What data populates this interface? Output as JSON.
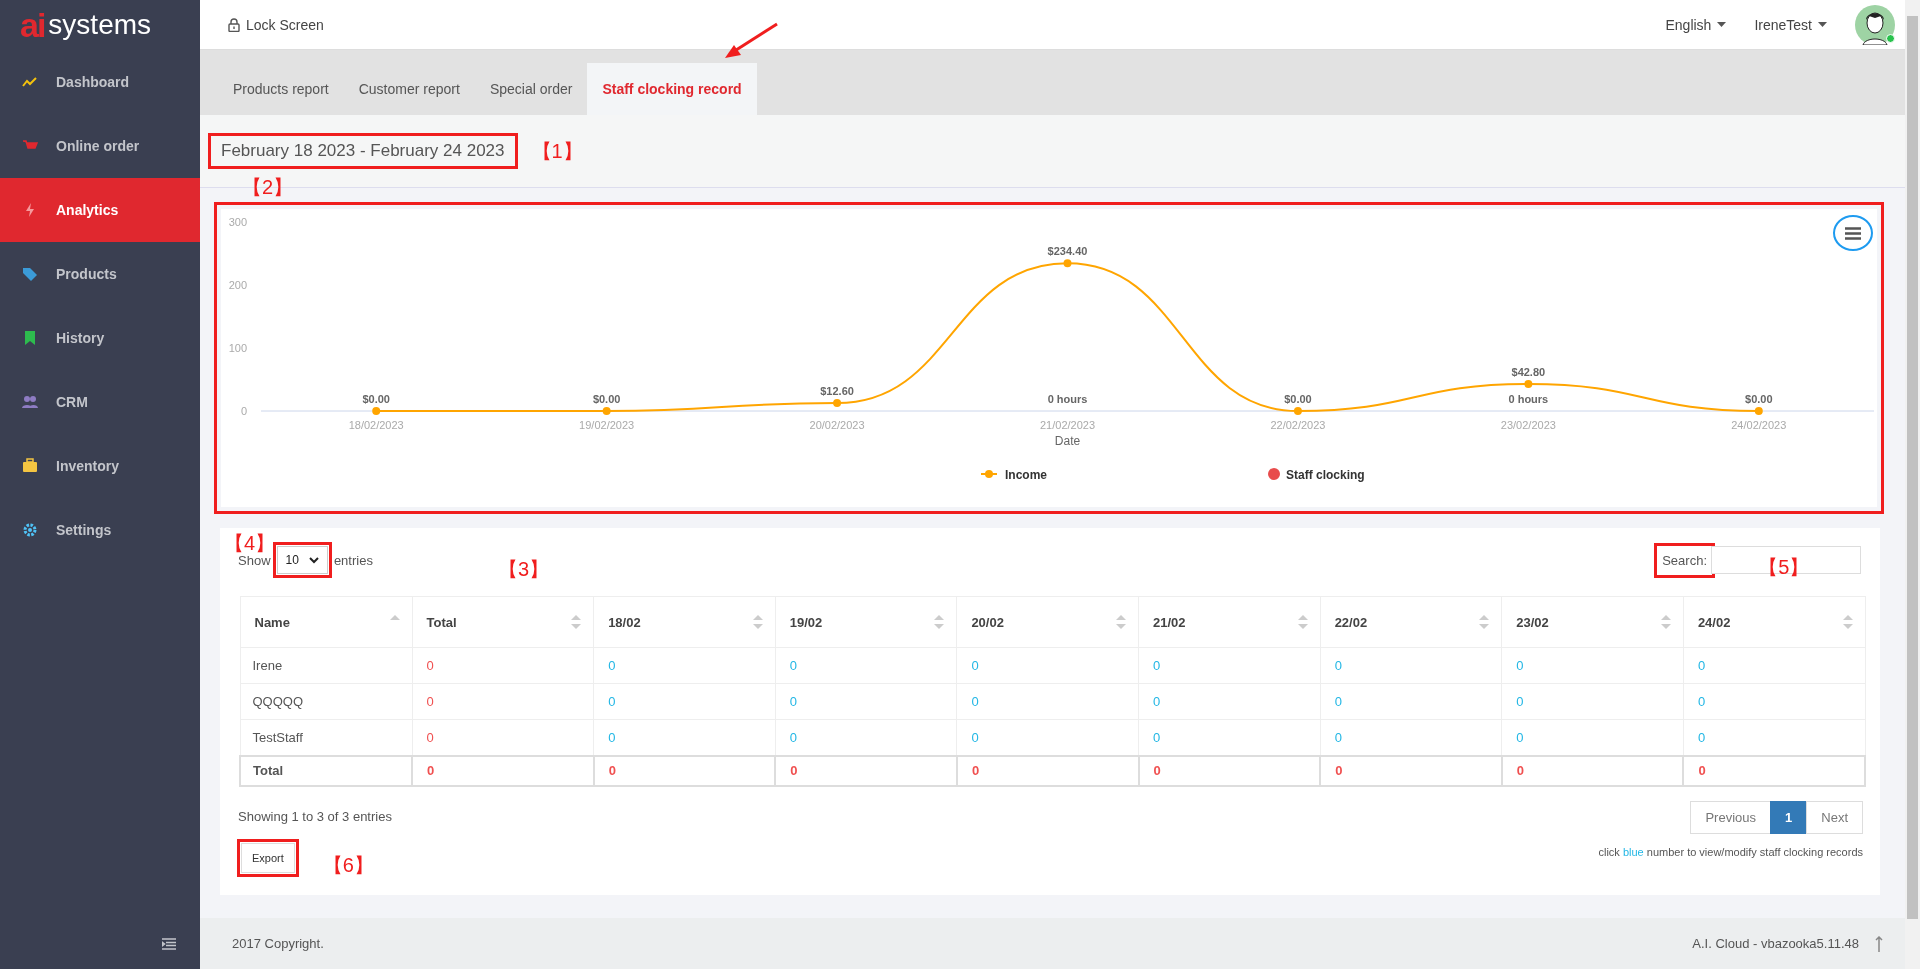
{
  "logo": {
    "mark": "ai",
    "text": "systems"
  },
  "sidebar": {
    "items": [
      {
        "label": "Dashboard",
        "selected": false
      },
      {
        "label": "Online order",
        "selected": false
      },
      {
        "label": "Analytics",
        "selected": true
      },
      {
        "label": "Products",
        "selected": false
      },
      {
        "label": "History",
        "selected": false
      },
      {
        "label": "CRM",
        "selected": false
      },
      {
        "label": "Inventory",
        "selected": false
      },
      {
        "label": "Settings",
        "selected": false
      }
    ]
  },
  "header": {
    "lock": "Lock Screen",
    "language": "English",
    "user": "IreneTest",
    "online": true
  },
  "tabs": [
    {
      "label": "Products report",
      "selected": false
    },
    {
      "label": "Customer report",
      "selected": false
    },
    {
      "label": "Special order",
      "selected": false
    },
    {
      "label": "Staff clocking record",
      "selected": true
    }
  ],
  "date_range": {
    "text": "February 18 2023 - February 24 2023",
    "annotation": "【1】"
  },
  "chart_panel": {
    "annotation": "【2】",
    "chart_data": {
      "type": "line",
      "xlabel": "Date",
      "categories": [
        "18/02/2023",
        "19/02/2023",
        "20/02/2023",
        "21/02/2023",
        "22/02/2023",
        "23/02/2023",
        "24/02/2023"
      ],
      "ylim": [
        0,
        300
      ],
      "yticks": [
        0,
        100,
        200,
        300
      ],
      "data_labels": true,
      "series": [
        {
          "name": "Income",
          "color": "#ffa500",
          "marker": true,
          "values": [
            0,
            0,
            12.6,
            234.4,
            0,
            42.8,
            0
          ],
          "value_labels": [
            "$0.00",
            "$0.00",
            "$12.60",
            "$234.40",
            "$0.00",
            "$42.80",
            "$0.00"
          ]
        },
        {
          "name": "Staff clocking",
          "color": "#e84c4c",
          "values": [
            null,
            null,
            null,
            null,
            null,
            null,
            null
          ]
        }
      ],
      "annotations": [
        "0 hours",
        "0 hours"
      ]
    }
  },
  "table_panel": {
    "annotation": "【3】",
    "length": {
      "label_before": "Show",
      "value": "10",
      "label_after": "entries",
      "annotation": "【4】"
    },
    "search": {
      "label": "Search:",
      "annotation": "【5】"
    },
    "columns": [
      {
        "label": "Name",
        "sorted": true
      },
      {
        "label": "Total",
        "sorted": false
      },
      {
        "label": "18/02",
        "sorted": false
      },
      {
        "label": "19/02",
        "sorted": false
      },
      {
        "label": "20/02",
        "sorted": false
      },
      {
        "label": "21/02",
        "sorted": false
      },
      {
        "label": "22/02",
        "sorted": false
      },
      {
        "label": "23/02",
        "sorted": false
      },
      {
        "label": "24/02",
        "sorted": false
      }
    ],
    "rows": [
      {
        "name": "Irene",
        "total": "0",
        "days": [
          "0",
          "0",
          "0",
          "0",
          "0",
          "0",
          "0"
        ]
      },
      {
        "name": "QQQQQ",
        "total": "0",
        "days": [
          "0",
          "0",
          "0",
          "0",
          "0",
          "0",
          "0"
        ]
      },
      {
        "name": "TestStaff",
        "total": "0",
        "days": [
          "0",
          "0",
          "0",
          "0",
          "0",
          "0",
          "0"
        ]
      }
    ],
    "total_row": {
      "name": "Total",
      "total": "0",
      "days": [
        "0",
        "0",
        "0",
        "0",
        "0",
        "0",
        "0"
      ]
    },
    "info": "Showing 1 to 3 of 3 entries",
    "pagination": [
      {
        "label": "Previous",
        "selected": false
      },
      {
        "label": "1",
        "selected": true
      },
      {
        "label": "Next",
        "selected": false
      }
    ],
    "export": {
      "label": "Export",
      "annotation": "【6】"
    },
    "note": {
      "before": "click ",
      "highlight": "blue",
      "after": " number to view/modify staff clocking records"
    }
  },
  "footer": {
    "copyright": "2017 Copyright.",
    "version": "A.I. Cloud - vbazooka5.11.48"
  }
}
